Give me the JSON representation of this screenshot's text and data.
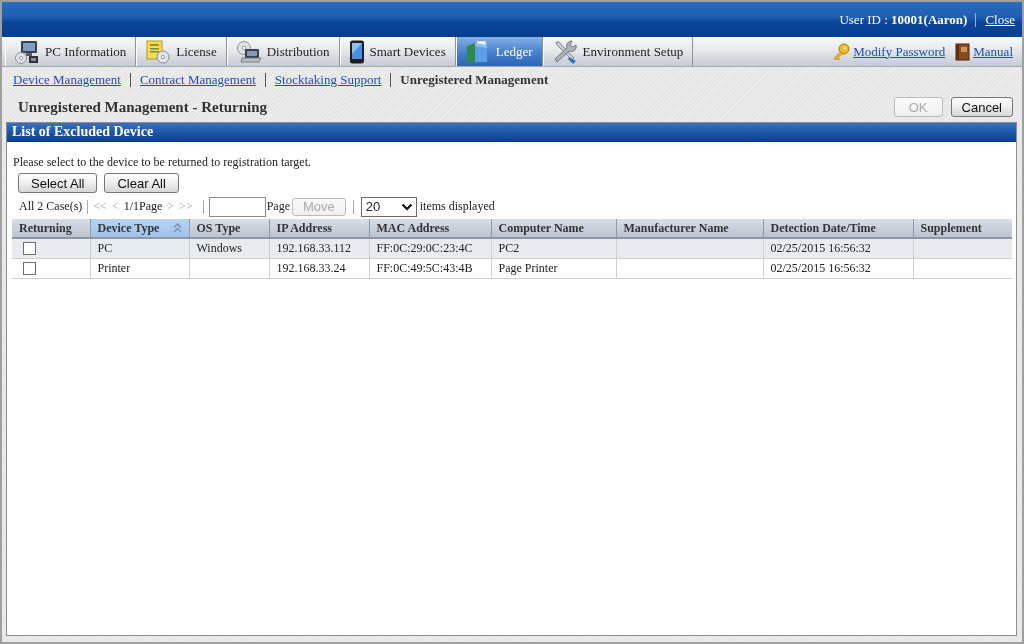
{
  "header": {
    "user_id": "User ID : **10001(Aaron)**",
    "close_link": "Close"
  },
  "tabs": [
    {
      "label": "PC Information",
      "selected": false
    },
    {
      "label": "License",
      "selected": false
    },
    {
      "label": "Distribution",
      "selected": false
    },
    {
      "label": "Smart Devices",
      "selected": false
    },
    {
      "label": "Ledger",
      "selected": true
    },
    {
      "label": "Environment Setup",
      "selected": false
    }
  ],
  "header_links": [
    "Modify Password",
    "Manual"
  ],
  "subnav": [
    {
      "label": "Device Management",
      "selected": false
    },
    {
      "label": "Contract Management",
      "selected": false
    },
    {
      "label": "Stocktaking Support",
      "selected": false
    },
    {
      "label": "Unregistered Management",
      "selected": true
    }
  ],
  "page_title": "Unregistered Management - Returning",
  "actions": [
    {
      "label": "OK",
      "disabled": true
    },
    {
      "label": "Cancel",
      "disabled": false
    }
  ],
  "panel": {
    "title": "List of Excluded Device",
    "instruction": "Please select to the device to be returned to registration target.",
    "buttons": [
      "Select All",
      "Clear All"
    ],
    "pagination": {
      "total": "All 2 Case(s)",
      "nav_back": [
        {
          "label": "<<",
          "disabled": true
        },
        {
          "label": "<",
          "disabled": true
        }
      ],
      "page_info": "1/1Page",
      "nav_forward": [
        {
          "label": ">",
          "disabled": true
        },
        {
          "label": ">>",
          "disabled": true
        }
      ],
      "page_label": "Page",
      "move_button": {
        "label": "Move",
        "disabled": true
      },
      "per_page": "20",
      "per_page_label": "items displayed"
    },
    "table": {
      "columns": [
        {
          "label": "Returning",
          "sorted": false
        },
        {
          "label": "Device Type",
          "sorted": true
        },
        {
          "label": "OS Type",
          "sorted": false
        },
        {
          "label": "IP Address",
          "sorted": false
        },
        {
          "label": "MAC Address",
          "sorted": false
        },
        {
          "label": "Computer Name",
          "sorted": false
        },
        {
          "label": "Manufacturer Name",
          "sorted": false
        },
        {
          "label": "Detection Date/Time",
          "sorted": false
        },
        {
          "label": "Supplement",
          "sorted": false
        }
      ],
      "rows": [
        {
          "cells": [
            {
              "kind": "checkbox",
              "checked": false
            },
            "PC",
            "Windows",
            "192.168.33.112",
            "FF:0C:29:0C:23:4C",
            "PC2",
            "",
            "02/25/2015 16:56:32",
            ""
          ]
        },
        {
          "cells": [
            {
              "kind": "checkbox",
              "checked": false
            },
            "Printer",
            "",
            "192.168.33.24",
            "FF:0C:49:5C:43:4B",
            "Page Printer",
            "",
            "02/25/2015 16:56:32",
            ""
          ]
        }
      ]
    }
  }
}
